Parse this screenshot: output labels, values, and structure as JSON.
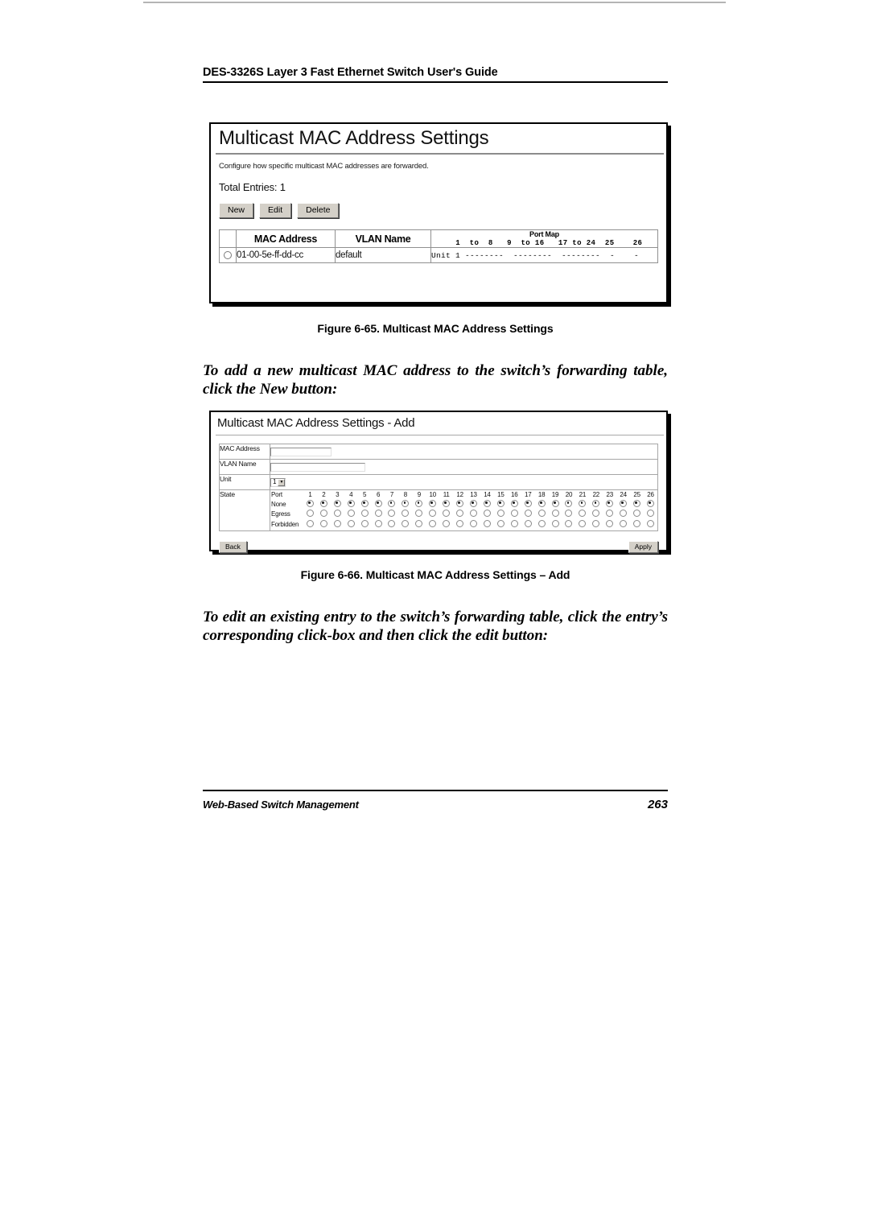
{
  "document": {
    "running_header": "DES-3326S Layer 3 Fast Ethernet Switch User's Guide",
    "footer_left": "Web-Based Switch Management",
    "page_number": "263"
  },
  "figure_65": {
    "caption": "Figure 6-65.  Multicast MAC Address Settings",
    "window_title": "Multicast MAC Address Settings",
    "description": "Configure how specific multicast MAC addresses are forwarded.",
    "total_entries": "Total Entries: 1",
    "buttons": [
      {
        "label": "New",
        "name": "new-button"
      },
      {
        "label": "Edit",
        "name": "edit-button"
      },
      {
        "label": "Delete",
        "name": "delete-button"
      }
    ],
    "table": {
      "headers": {
        "select": "",
        "mac_address": "MAC Address",
        "vlan_name": "VLAN Name",
        "port_map": "Port Map",
        "port_map_scale": "  1  to  8   9  to 16   17 to 24  25    26"
      },
      "rows": [
        {
          "selected": false,
          "mac_address": "01-00-5e-ff-dd-cc",
          "vlan_name": "default",
          "port_map": "Unit 1 --------  --------  --------  -    -"
        }
      ]
    }
  },
  "figure_66": {
    "caption": "Figure 6-66.  Multicast MAC Address Settings – Add",
    "window_title": "Multicast MAC Address Settings - Add",
    "fields": {
      "mac_address_label": "MAC  Address",
      "mac_address_value": "",
      "vlan_name_label": "VLAN Name",
      "vlan_name_value": "",
      "unit_label": "Unit",
      "unit_value": "1",
      "state_label": "State"
    },
    "state_grid": {
      "port_row_label": "Port",
      "ports": [
        "1",
        "2",
        "3",
        "4",
        "5",
        "6",
        "7",
        "8",
        "9",
        "10",
        "11",
        "12",
        "13",
        "14",
        "15",
        "16",
        "17",
        "18",
        "19",
        "20",
        "21",
        "22",
        "23",
        "24",
        "25",
        "26"
      ],
      "rows": [
        {
          "label": "None",
          "selected_all": true
        },
        {
          "label": "Egress",
          "selected_all": false
        },
        {
          "label": "Forbidden",
          "selected_all": false
        }
      ]
    },
    "buttons": [
      {
        "label": "Back",
        "name": "back-button"
      },
      {
        "label": "Apply",
        "name": "apply-button"
      }
    ]
  },
  "prose": {
    "p1": "To add a new multicast MAC address to the switch’s forwarding table, click the New button:",
    "p2": "To edit an existing entry to the switch’s forwarding table, click the entry’s corresponding click-box and then click the edit button:"
  }
}
